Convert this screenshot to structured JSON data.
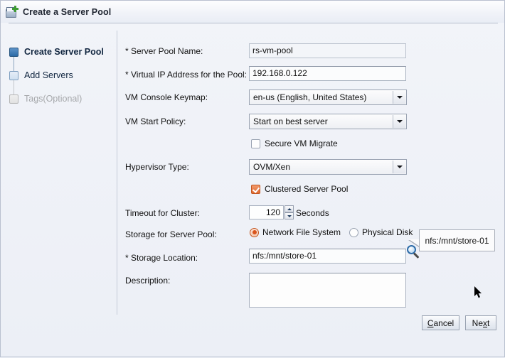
{
  "window": {
    "title": "Create a Server Pool",
    "title_icon": "server-pool-add-icon"
  },
  "sidebar": {
    "steps": [
      {
        "label": "Create Server Pool",
        "state": "active"
      },
      {
        "label": "Add Servers",
        "state": "pending"
      },
      {
        "label": "Tags(Optional)",
        "state": "disabled"
      }
    ]
  },
  "form": {
    "server_pool_name": {
      "label": "* Server Pool Name:",
      "value": "rs-vm-pool"
    },
    "virtual_ip": {
      "label": "* Virtual IP Address for the Pool:",
      "value": "192.168.0.122"
    },
    "vm_console_keymap": {
      "label": "VM Console Keymap:",
      "value": "en-us (English, United States)"
    },
    "vm_start_policy": {
      "label": "VM Start Policy:",
      "value": "Start on best server"
    },
    "secure_vm_migrate": {
      "label": "Secure VM Migrate",
      "checked": false
    },
    "hypervisor_type": {
      "label": "Hypervisor Type:",
      "value": "OVM/Xen"
    },
    "clustered_server_pool": {
      "label": "Clustered Server Pool",
      "checked": true
    },
    "timeout_for_cluster": {
      "label": "Timeout for Cluster:",
      "value": "120",
      "units": "Seconds"
    },
    "storage_for_server_pool": {
      "label": "Storage for Server Pool:",
      "option_nfs": "Network File System",
      "option_physical": "Physical Disk",
      "selected": "Network File System"
    },
    "storage_location": {
      "label": "* Storage Location:",
      "value": "nfs:/mnt/store-01",
      "browse_icon": "magnifier-icon"
    },
    "description": {
      "label": "Description:",
      "value": ""
    }
  },
  "tooltip": {
    "text": "nfs:/mnt/store-01"
  },
  "buttons": {
    "cancel": {
      "pre": "C",
      "post": "ancel"
    },
    "next": {
      "pre": "Ne",
      "mn": "x",
      "post": "t"
    },
    "cancel_label": "Cancel",
    "next_label": "Next"
  },
  "colors": {
    "accent_orange": "#d9541c",
    "active_step_blue": "#2c6aa6",
    "panel_bg": "#eef1f7"
  }
}
